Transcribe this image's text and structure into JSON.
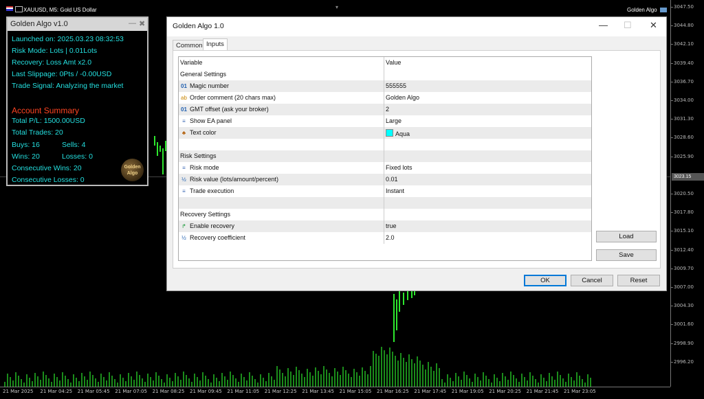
{
  "chart": {
    "symbol_title": "XAUUSD, M5:  Gold US Dollar",
    "ea_label": "Golden Algo",
    "prices": [
      "3047.50",
      "3044.80",
      "3042.10",
      "3039.40",
      "3036.70",
      "3034.00",
      "3031.30",
      "3028.60",
      "3025.90",
      "3023.15",
      "3020.50",
      "3017.80",
      "3015.10",
      "3012.40",
      "3009.70",
      "3007.00",
      "3004.30",
      "3001.60",
      "2998.90",
      "2996.20"
    ],
    "current_price": "3023.15",
    "times": [
      "21 Mar 2025",
      "21 Mar 04:25",
      "21 Mar 05:45",
      "21 Mar 07:05",
      "21 Mar 08:25",
      "21 Mar 09:45",
      "21 Mar 11:05",
      "21 Mar 12:25",
      "21 Mar 13:45",
      "21 Mar 15:05",
      "21 Mar 16:25",
      "21 Mar 17:45",
      "21 Mar 19:05",
      "21 Mar 20:25",
      "21 Mar 21:45",
      "21 Mar 23:05"
    ]
  },
  "panel": {
    "title": "Golden Algo v1.0",
    "min_glyph": "—",
    "close_glyph": "✖",
    "launched": "Launched on: 2025.03.23 08:32:53",
    "risk_mode": "Risk Mode: Lots | 0.01Lots",
    "recovery": "Recovery: Loss Amt x2.0",
    "slippage": "Last Slippage: 0Pts / -0.00USD",
    "signal": "Trade Signal: Analyzing the market",
    "summary_title": "Account Summary",
    "total_pl": "Total P/L: 1500.00USD",
    "total_trades": "Total Trades: 20",
    "buys": "Buys: 16",
    "sells": "Sells: 4",
    "wins": "Wins: 20",
    "losses": "Losses: 0",
    "cons_wins": "Consecutive Wins: 20",
    "cons_losses": "Consecutive Losses: 0",
    "logo_line1": "Golden",
    "logo_line2": "Algo"
  },
  "dialog": {
    "title": "Golden Algo 1.0",
    "minimize": "—",
    "maximize": "☐",
    "close": "✕",
    "tabs": [
      "Common",
      "Inputs"
    ],
    "active_tab": "Inputs",
    "headers": {
      "variable": "Variable",
      "value": "Value"
    },
    "rows": [
      {
        "kind": "section",
        "variable": "General Settings",
        "value": ""
      },
      {
        "kind": "param",
        "icon": "01",
        "variable": "Magic number",
        "value": "555555"
      },
      {
        "kind": "param",
        "icon": "ab",
        "variable": "Order comment (20 chars max)",
        "value": "Golden Algo"
      },
      {
        "kind": "param",
        "icon": "01",
        "variable": "GMT offset (ask your broker)",
        "value": "2"
      },
      {
        "kind": "param",
        "icon": "≡",
        "variable": "Show EA panel",
        "value": "Large"
      },
      {
        "kind": "param",
        "icon": "♣",
        "variable": "Text color",
        "value": "Aqua"
      },
      {
        "kind": "blank",
        "variable": "",
        "value": ""
      },
      {
        "kind": "section",
        "variable": "Risk Settings",
        "value": ""
      },
      {
        "kind": "param",
        "icon": "≡",
        "variable": "Risk mode",
        "value": "Fixed lots"
      },
      {
        "kind": "param",
        "icon": "½",
        "variable": "Risk value (lots/amount/percent)",
        "value": "0.01"
      },
      {
        "kind": "param",
        "icon": "≡",
        "variable": "Trade execution",
        "value": "Instant"
      },
      {
        "kind": "blank",
        "variable": "",
        "value": ""
      },
      {
        "kind": "section",
        "variable": "Recovery Settings",
        "value": ""
      },
      {
        "kind": "param",
        "icon": "↱",
        "variable": "Enable recovery",
        "value": "true"
      },
      {
        "kind": "param",
        "icon": "½",
        "variable": "Recovery coefficient",
        "value": "2.0"
      }
    ],
    "text_color_swatch": "#00ffff",
    "buttons": {
      "load": "Load",
      "save": "Save",
      "ok": "OK",
      "cancel": "Cancel",
      "reset": "Reset"
    }
  }
}
